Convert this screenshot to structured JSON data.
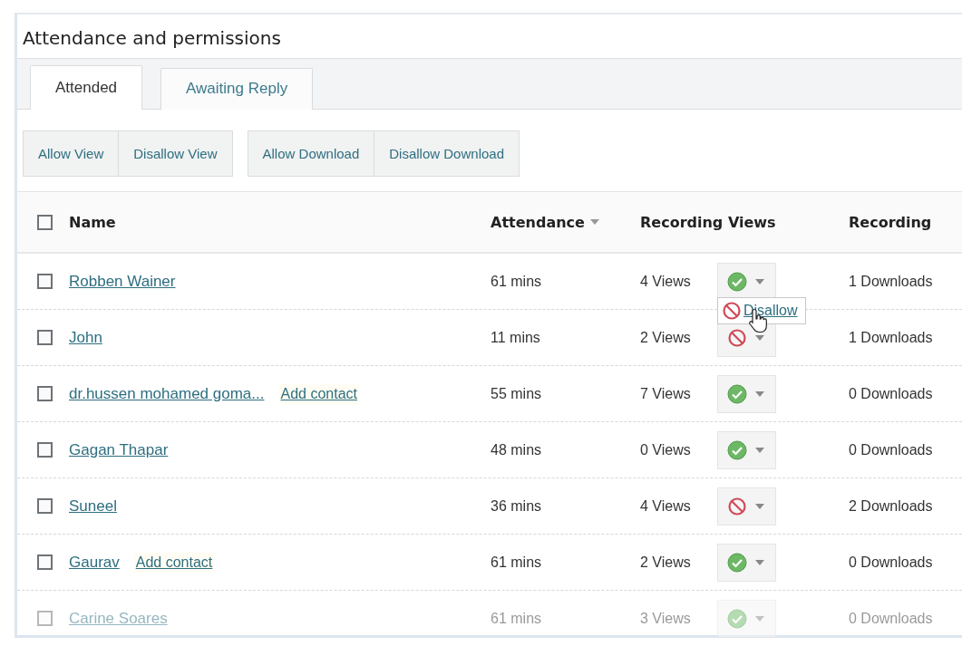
{
  "title": "Attendance and permissions",
  "tabs": [
    {
      "label": "Attended",
      "selected": true
    },
    {
      "label": "Awaiting Reply",
      "selected": false
    }
  ],
  "button_groups": [
    [
      "Allow View",
      "Disallow View"
    ],
    [
      "Allow Download",
      "Disallow Download"
    ]
  ],
  "table": {
    "columns": [
      {
        "label": "Name",
        "kind": "check"
      },
      {
        "label": "Attendance",
        "kind": "sort"
      },
      {
        "label": "Recording Views",
        "kind": "plain"
      },
      {
        "kind": "blank"
      },
      {
        "label": "Recording",
        "kind": "plain"
      }
    ],
    "header_checked": false,
    "rows": [
      {
        "checked": false,
        "name": "Robben Wainer",
        "add_contact": null,
        "attendance": "61 mins",
        "views": "4 Views",
        "view_allowed": true,
        "downloads": "1 Downloads",
        "faded": false,
        "menu": {
          "label": "Disallow",
          "view_allowed": false
        }
      },
      {
        "checked": false,
        "name": "John",
        "add_contact": null,
        "attendance": "11 mins",
        "views": "2 Views",
        "view_allowed": false,
        "downloads": "1 Downloads",
        "faded": false,
        "menu": null
      },
      {
        "checked": false,
        "name": "dr.hussen mohamed goma...",
        "add_contact": "Add contact",
        "attendance": "55 mins",
        "views": "7 Views",
        "view_allowed": true,
        "downloads": "0 Downloads",
        "faded": false,
        "menu": null
      },
      {
        "checked": false,
        "name": "Gagan Thapar",
        "add_contact": null,
        "attendance": "48 mins",
        "views": "0 Views",
        "view_allowed": true,
        "downloads": "0 Downloads",
        "faded": false,
        "menu": null
      },
      {
        "checked": false,
        "name": "Suneel",
        "add_contact": null,
        "attendance": "36 mins",
        "views": "4 Views",
        "view_allowed": false,
        "downloads": "2 Downloads",
        "faded": false,
        "menu": null
      },
      {
        "checked": false,
        "name": "Gaurav",
        "add_contact": "Add contact",
        "attendance": "61 mins",
        "views": "2 Views",
        "view_allowed": true,
        "downloads": "0 Downloads",
        "faded": false,
        "menu": null
      },
      {
        "checked": false,
        "name": "Carine Soares",
        "add_contact": null,
        "attendance": "61 mins",
        "views": "3 Views",
        "view_allowed": true,
        "downloads": "0 Downloads",
        "faded": true,
        "menu": null
      }
    ]
  }
}
